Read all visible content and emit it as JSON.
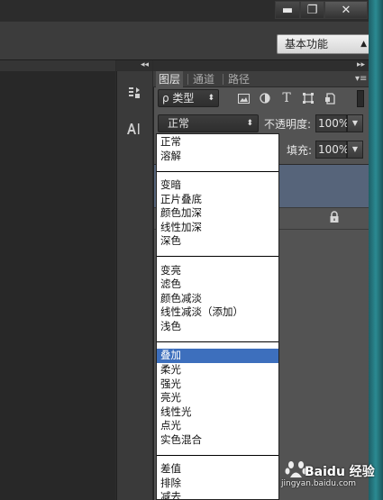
{
  "window": {
    "minimize_label": "▬",
    "maximize_label": "❐",
    "close_label": "✕"
  },
  "workspace": {
    "label": "基本功能"
  },
  "dock": {
    "collapse_label": "◂◂"
  },
  "panel": {
    "collapse_label": "▸▸",
    "menu_label": "▾≡",
    "tabs": [
      {
        "label": "图层",
        "active": true
      },
      {
        "label": "通道",
        "active": false
      },
      {
        "label": "路径",
        "active": false
      }
    ],
    "filter": {
      "label": "ρ 类型",
      "icons": [
        "image-icon",
        "adjustment-icon",
        "type-icon",
        "shape-icon",
        "smart-object-icon"
      ]
    },
    "blend_mode": {
      "value": "正常"
    },
    "opacity": {
      "label": "不透明度:",
      "value": "100%"
    },
    "fill": {
      "label": "填充:",
      "value": "100%"
    }
  },
  "dropdown": {
    "groups": [
      [
        "正常",
        "溶解"
      ],
      [
        "变暗",
        "正片叠底",
        "颜色加深",
        "线性加深",
        "深色"
      ],
      [
        "变亮",
        "滤色",
        "颜色减淡",
        "线性减淡（添加）",
        "浅色"
      ],
      [
        "叠加",
        "柔光",
        "强光",
        "亮光",
        "线性光",
        "点光",
        "实色混合"
      ],
      [
        "差值",
        "排除",
        "减去"
      ]
    ],
    "selected": "叠加"
  },
  "watermark": {
    "text": "Baidu 经验",
    "url": "jingyan.baidu.com"
  },
  "colors": {
    "selection": "#3d6fbd",
    "panel_bg": "#535353",
    "selected_layer": "#56647a"
  }
}
